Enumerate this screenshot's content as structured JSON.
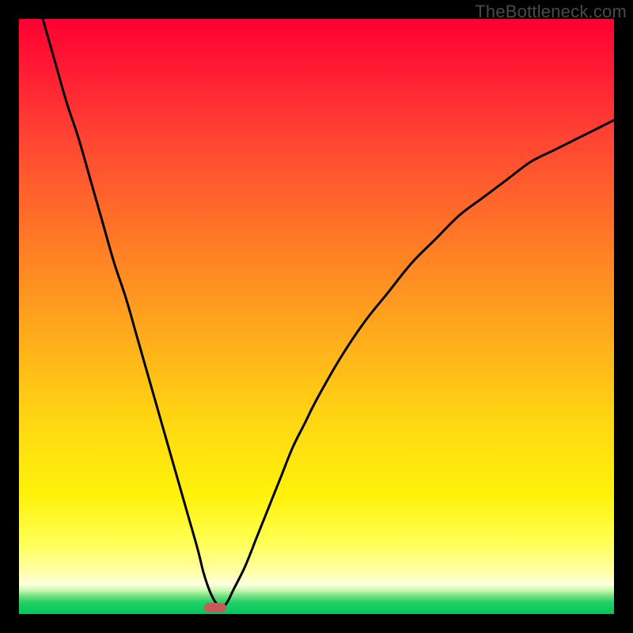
{
  "watermark": "TheBottleneck.com",
  "chart_data": {
    "type": "line",
    "title": "",
    "xlabel": "",
    "ylabel": "",
    "xlim": [
      0,
      100
    ],
    "ylim": [
      0,
      100
    ],
    "series": [
      {
        "name": "bottleneck-curve",
        "x": [
          4,
          6,
          8,
          10,
          12,
          14,
          16,
          18,
          20,
          22,
          24,
          26,
          28,
          30,
          31,
          32,
          33,
          34,
          35,
          36,
          38,
          40,
          42,
          44,
          46,
          48,
          50,
          54,
          58,
          62,
          66,
          70,
          74,
          78,
          82,
          86,
          90,
          94,
          98,
          100
        ],
        "values": [
          100,
          93,
          86,
          80,
          73,
          66,
          59,
          53,
          46,
          39,
          32,
          25,
          18,
          11,
          7,
          4,
          2,
          1,
          2,
          4,
          8,
          13,
          18,
          23,
          28,
          32,
          36,
          43,
          49,
          54,
          59,
          63,
          67,
          70,
          73,
          76,
          78,
          80,
          82,
          83
        ],
        "color": "#000000"
      }
    ],
    "marker": {
      "x": 33,
      "y": 1,
      "color": "#c65a5a"
    },
    "background_gradient": {
      "stops": [
        {
          "pos": 0,
          "color": "#ff0033"
        },
        {
          "pos": 50,
          "color": "#ff9922"
        },
        {
          "pos": 80,
          "color": "#fff200"
        },
        {
          "pos": 97,
          "color": "#ccffaa"
        },
        {
          "pos": 100,
          "color": "#00c85a"
        }
      ]
    }
  }
}
